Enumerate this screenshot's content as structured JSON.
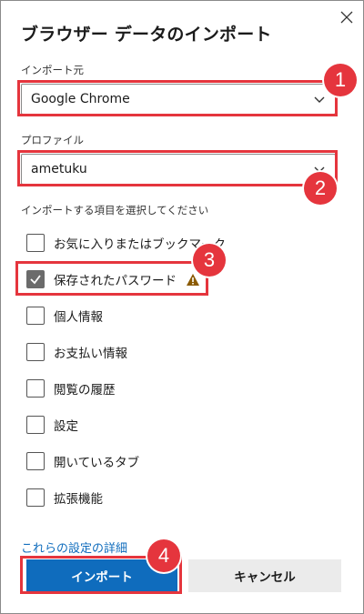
{
  "dialog": {
    "title": "ブラウザー データのインポート",
    "close_icon": "close-icon"
  },
  "source": {
    "label": "インポート元",
    "selected": "Google Chrome"
  },
  "profile": {
    "label": "プロファイル",
    "selected": "ametuku"
  },
  "items": {
    "label": "インポートする項目を選択してください",
    "list": [
      {
        "label": "お気に入りまたはブックマーク",
        "checked": false
      },
      {
        "label": "保存されたパスワード",
        "checked": true,
        "warning_icon": "warning-icon"
      },
      {
        "label": "個人情報",
        "checked": false
      },
      {
        "label": "お支払い情報",
        "checked": false
      },
      {
        "label": "閲覧の履歴",
        "checked": false
      },
      {
        "label": "設定",
        "checked": false
      },
      {
        "label": "開いているタブ",
        "checked": false
      },
      {
        "label": "拡張機能",
        "checked": false
      }
    ]
  },
  "footer": {
    "details_link": "これらの設定の詳細",
    "import_button": "インポート",
    "cancel_button": "キャンセル"
  },
  "annotations": {
    "badges": [
      "1",
      "2",
      "3",
      "4"
    ],
    "color": "#e5353d"
  },
  "colors": {
    "accent": "#0f6cbd",
    "warning": "#8a5a00"
  }
}
